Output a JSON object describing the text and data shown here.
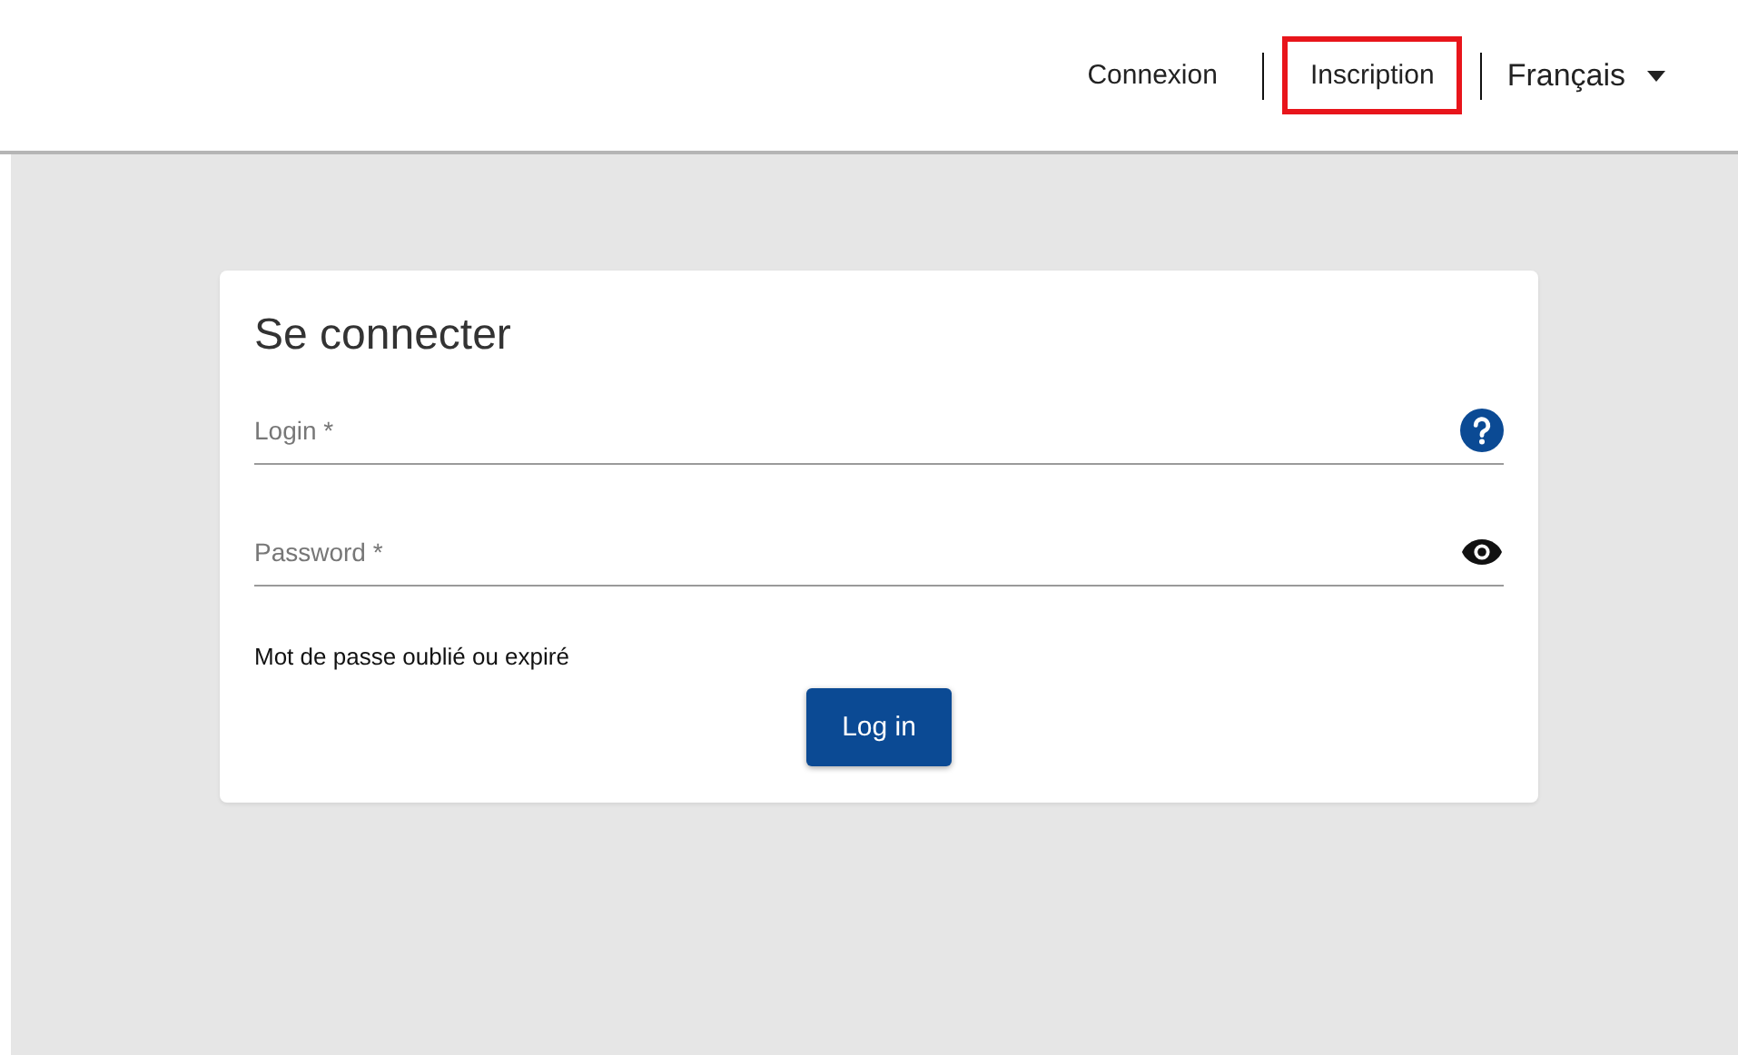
{
  "nav": {
    "links": [
      {
        "label": "Connexion",
        "highlighted": false
      },
      {
        "label": "Inscription",
        "highlighted": true
      }
    ],
    "language": {
      "label": "Français"
    }
  },
  "login_card": {
    "title": "Se connecter",
    "fields": [
      {
        "kind": "help",
        "placeholder": "Login *"
      },
      {
        "kind": "password",
        "placeholder": "Password *"
      }
    ],
    "forgot_link": "Mot de passe oublié ou expiré",
    "submit": "Log in"
  }
}
